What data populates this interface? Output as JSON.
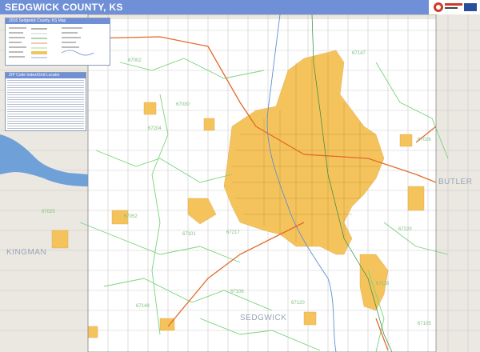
{
  "header": {
    "title": "SEDGWICK COUNTY, KS"
  },
  "legend": {
    "title": "2016 Sedgwick County, KS Map"
  },
  "zip_index": {
    "title": "ZIP Code Index/Grid Locator"
  },
  "county_labels": {
    "butler": "BUTLER",
    "kingman": "KINGMAN",
    "sedgwick": "SEDGWICK"
  },
  "zip_labels": [
    "67002",
    "67147",
    "67030",
    "67204",
    "67026",
    "67052",
    "67101",
    "67025",
    "67217",
    "67220",
    "67106",
    "67120",
    "67149",
    "67118",
    "67105"
  ],
  "colors": {
    "title_bar": "#6f8fd6",
    "urban": "#f5c35c",
    "lake": "#6fa0d8",
    "neighbor_county": "#e9e6df",
    "highway": "#e26a2c",
    "zip_boundary": "#7ad37a"
  },
  "icons": {
    "compass": "compass-rose-icon",
    "logo": "publisher-logo-icon"
  }
}
